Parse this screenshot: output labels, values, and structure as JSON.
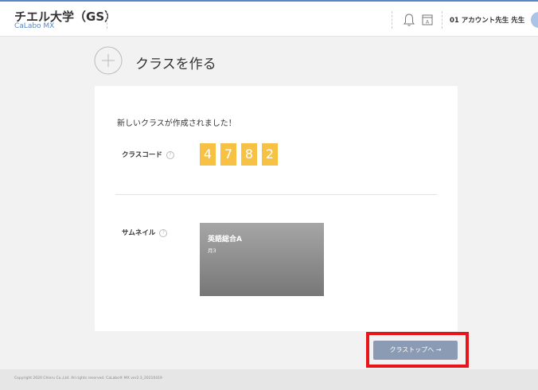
{
  "header": {
    "org_name": "チエル大学（GS）",
    "app_name": "CaLabo MX",
    "user_name": "01 アカウント先生 先生"
  },
  "page": {
    "title": "クラスを作る"
  },
  "card": {
    "success_message": "新しいクラスが作成されました！",
    "class_code_label": "クラスコード",
    "class_code_digits": [
      "4",
      "7",
      "8",
      "2"
    ],
    "thumbnail_label": "サムネイル",
    "thumbnail_title": "英語総合A",
    "thumbnail_sub": "月3",
    "help_glyph": "?"
  },
  "actions": {
    "next_label": "クラストップへ →"
  },
  "footer": {
    "copyright": "Copyright 2020 Chieru Co.,Ltd. All rights reserved. CaLabo® MX ver2.3_20210419"
  },
  "colors": {
    "accent": "#5b87c5",
    "code_digit_bg": "#f7c244",
    "button_bg": "#8a9bb3",
    "highlight_border": "#e8161b"
  }
}
